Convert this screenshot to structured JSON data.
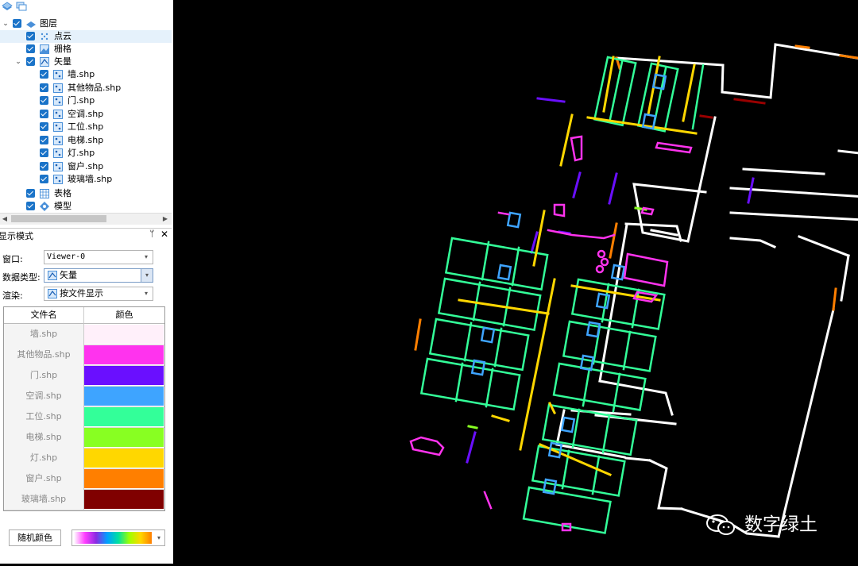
{
  "layer_tree": {
    "root": {
      "label": "图层"
    },
    "point_cloud": {
      "label": "点云"
    },
    "raster": {
      "label": "栅格"
    },
    "vector": {
      "label": "矢量"
    },
    "vector_children": [
      {
        "label": "墙.shp"
      },
      {
        "label": "其他物品.shp"
      },
      {
        "label": "门.shp"
      },
      {
        "label": "空调.shp"
      },
      {
        "label": "工位.shp"
      },
      {
        "label": "电梯.shp"
      },
      {
        "label": "灯.shp"
      },
      {
        "label": "窗户.shp"
      },
      {
        "label": "玻璃墙.shp"
      }
    ],
    "table": {
      "label": "表格"
    },
    "model": {
      "label": "模型"
    }
  },
  "display_panel": {
    "title": "显示模式",
    "window_label": "窗口:",
    "window_value": "Viewer-0",
    "datatype_label": "数据类型:",
    "datatype_value": "矢量",
    "render_label": "渲染:",
    "render_value": "按文件显示",
    "table_headers": {
      "filename": "文件名",
      "color": "颜色"
    },
    "rows": [
      {
        "file": "墙.shp",
        "color": "#fff0fa"
      },
      {
        "file": "其他物品.shp",
        "color": "#ff33ee"
      },
      {
        "file": "门.shp",
        "color": "#6a0fff"
      },
      {
        "file": "空调.shp",
        "color": "#3ea4ff"
      },
      {
        "file": "工位.shp",
        "color": "#33ff99"
      },
      {
        "file": "电梯.shp",
        "color": "#88ff22"
      },
      {
        "file": "灯.shp",
        "color": "#ffd700"
      },
      {
        "file": "窗户.shp",
        "color": "#ff7f00"
      },
      {
        "file": "玻璃墙.shp",
        "color": "#800000"
      }
    ],
    "random_color_button": "随机颜色"
  },
  "watermark": {
    "text": "数字绿土"
  }
}
